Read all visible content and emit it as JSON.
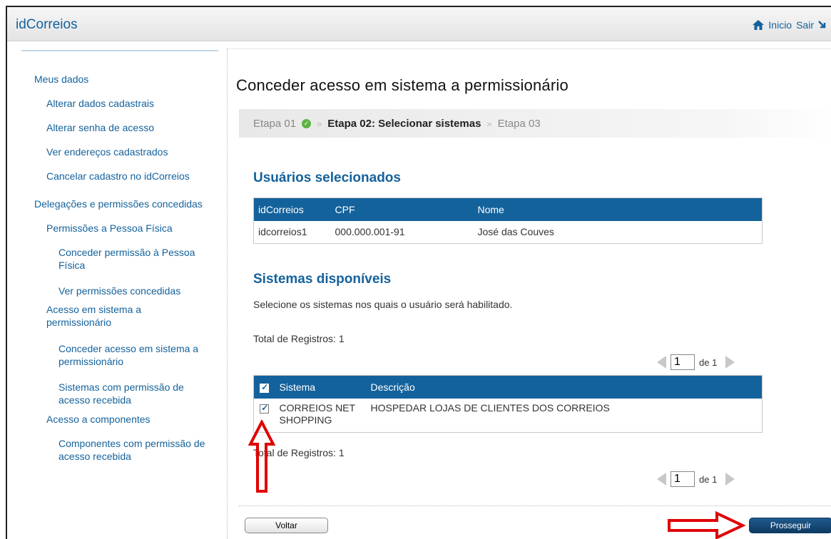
{
  "header": {
    "brand": "idCorreios",
    "home_label": "Inicio",
    "logout_label": "Sair"
  },
  "sidebar": {
    "items": [
      {
        "label": "Meus dados"
      },
      {
        "label": "Alterar dados cadastrais"
      },
      {
        "label": "Alterar senha de acesso"
      },
      {
        "label": "Ver endereços cadastrados"
      },
      {
        "label": "Cancelar cadastro no idCorreios"
      },
      {
        "label": "Delegações e permissões concedidas"
      },
      {
        "label": "Permissões a Pessoa Física"
      },
      {
        "label": "Conceder permissão à Pessoa Física"
      },
      {
        "label": "Ver permissões concedidas"
      },
      {
        "label": "Acesso em sistema a permissionário"
      },
      {
        "label": "Conceder acesso em sistema a permissionário"
      },
      {
        "label": "Sistemas com permissão de acesso recebida"
      },
      {
        "label": "Acesso a componentes"
      },
      {
        "label": "Componentes com permissão de acesso recebida"
      }
    ]
  },
  "main": {
    "title": "Conceder acesso em sistema a permissionário",
    "steps": {
      "step1": "Etapa 01",
      "step2": "Etapa 02: Selecionar sistemas",
      "step3": "Etapa 03"
    },
    "users_section": {
      "title": "Usuários selecionados",
      "columns": [
        "idCorreios",
        "CPF",
        "Nome"
      ],
      "rows": [
        {
          "idcorreios": "idcorreios1",
          "cpf": "000.000.001-91",
          "nome": "José das Couves"
        }
      ]
    },
    "systems_section": {
      "title": "Sistemas disponíveis",
      "instruction": "Selecione os sistemas nos quais o usuário será habilitado.",
      "total_top": "Total de Registros: 1",
      "total_bottom": "Total de Registros: 1",
      "pager": {
        "page": "1",
        "of_label": "de 1"
      },
      "columns": [
        "Sistema",
        "Descrição"
      ],
      "rows": [
        {
          "sistema": "CORREIOS NET SHOPPING",
          "descricao": "HOSPEDAR LOJAS DE CLIENTES DOS CORREIOS",
          "checked": true
        }
      ]
    },
    "buttons": {
      "back": "Voltar",
      "next": "Prosseguir"
    }
  },
  "colors": {
    "accent": "#14629c",
    "annotation_arrow": "#e00000"
  }
}
